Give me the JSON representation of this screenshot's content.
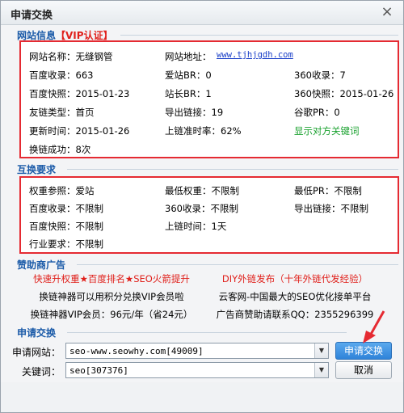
{
  "window": {
    "title": "申请交换",
    "close_glyph": "×"
  },
  "site_info": {
    "heading": "网站信息",
    "vip_badge": "【VIP认证】",
    "rows": [
      [
        "网站名称：无缝钢管",
        "网站地址：",
        "www.tjhjgdh.com"
      ],
      [
        "百度收录：663",
        "爱站BR：0",
        "360收录：7"
      ],
      [
        "百度快照：2015-01-23",
        "站长BR：1",
        "360快照：2015-01-26"
      ],
      [
        "友链类型：首页",
        "导出链接：19",
        "谷歌PR：0"
      ],
      [
        "更新时间：2015-01-26",
        "上链准时率：62%",
        "显示对方关键词"
      ],
      [
        "换链成功：8次"
      ]
    ]
  },
  "requirements": {
    "heading": "互换要求",
    "rows": [
      [
        "权重参照：爱站",
        "最低权重：不限制",
        "最低PR：不限制"
      ],
      [
        "百度收录：不限制",
        "360收录：不限制",
        "导出链接：不限制"
      ],
      [
        "百度快照：不限制",
        "上链时间：1天"
      ],
      [
        "行业要求：不限制"
      ]
    ]
  },
  "sponsor": {
    "heading": "赞助商广告",
    "ads": [
      [
        "快速升权重★百度排名★SEO火箭提升",
        "DIY外链发布（十年外链代发经验）"
      ],
      [
        "换链神器可以用积分兑换VIP会员啦",
        "云客网-中国最大的SEO优化接单平台"
      ],
      [
        "换链神器VIP会员：96元/年（省24元）",
        "广告商赞助请联系QQ：2355296399"
      ]
    ]
  },
  "apply": {
    "heading": "申请交换",
    "site_label": "申请网站：",
    "site_value": "seo-www.seowhy.com[49009]",
    "keyword_label": "关键词：",
    "keyword_value": "seo[307376]",
    "submit_label": "申请交换",
    "cancel_label": "取消"
  },
  "colors": {
    "accent": "#1a5aa8",
    "highlight_border": "#e52a32",
    "red_text": "#e0201b",
    "green_text": "#19a12e",
    "link": "#1a3fc8"
  }
}
